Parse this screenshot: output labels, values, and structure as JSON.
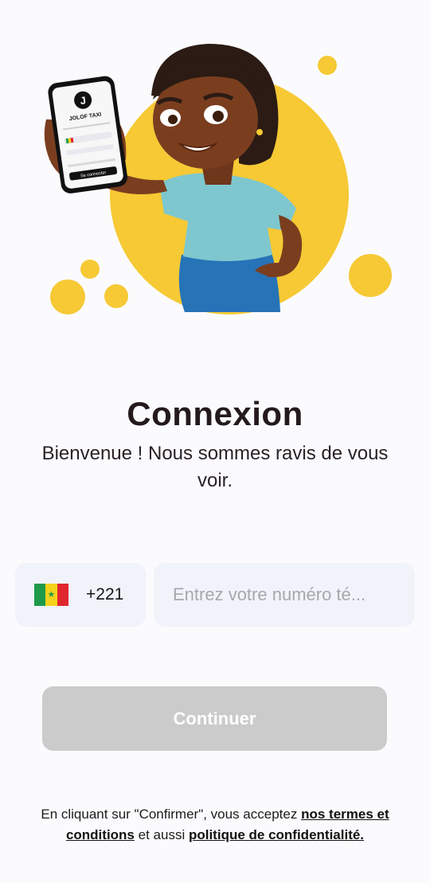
{
  "hero": {
    "phone_logo_letter": "J",
    "phone_brand": "JOLOF TAXI",
    "phone_button": "Se connecter",
    "colors": {
      "accent_yellow": "#f6c935",
      "shirt": "#7ec7cf",
      "pants": "#2773b8",
      "skin": "#7a3e1f",
      "hair": "#2b1b14"
    }
  },
  "title": "Connexion",
  "subtitle": "Bienvenue ! Nous sommes ravis de vous voir.",
  "country": {
    "flag": "senegal-flag",
    "dial_code": "+221"
  },
  "phone": {
    "placeholder": "Entrez votre numéro té...",
    "value": ""
  },
  "continue_label": "Continuer",
  "terms": {
    "prefix": "En cliquant sur \"Confirmer\", vous acceptez",
    "link1": "nos termes et conditions",
    "middle": "et aussi",
    "link2": "politique de confidentialité."
  }
}
